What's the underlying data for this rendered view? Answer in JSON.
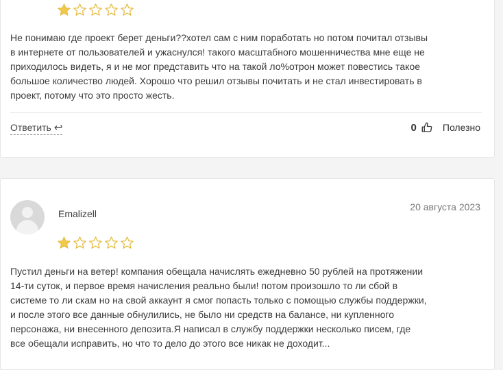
{
  "colors": {
    "star_filled": "#f2c94c",
    "star_outline": "#e2b93b"
  },
  "reviews": [
    {
      "rating": 1,
      "text": "Не понимаю где проект берет деньги??хотел сам с ним поработать но потом почитал отзывы\nв интернете от пользователей и ужаснулся! такого масштабного мошенничества мне еще не\nприходилось видеть, я и не мог представить что на такой ло%отрон может повестись такое\nбольшое количество людей. Хорошо что решил отзывы почитать и не стал инвестировать в\nпроект, потому что это просто жесть.",
      "reply_label": "Ответить",
      "reply_icon": "↩",
      "helpful_count": "0",
      "helpful_label": "Полезно"
    },
    {
      "author": "Emalizell",
      "date": "20 августа 2023",
      "rating": 1,
      "text": "Пустил деньги на ветер! компания обещала начислять ежедневно 50 рублей на протяжении\n14-ти суток, и первое время начисления реально были! потом произошло то ли сбой в\nсистеме то ли скам но на свой аккаунт я смог попасть только с помощью службы поддержки,\nи после этого все данные обнулились, не было ни средств на балансе, ни купленного\nперсонажа, ни внесенного депозита.Я написал в службу поддержки несколько писем, где\nвсе обещали исправить, но что то дело до этого все никак не доходит..."
    }
  ]
}
